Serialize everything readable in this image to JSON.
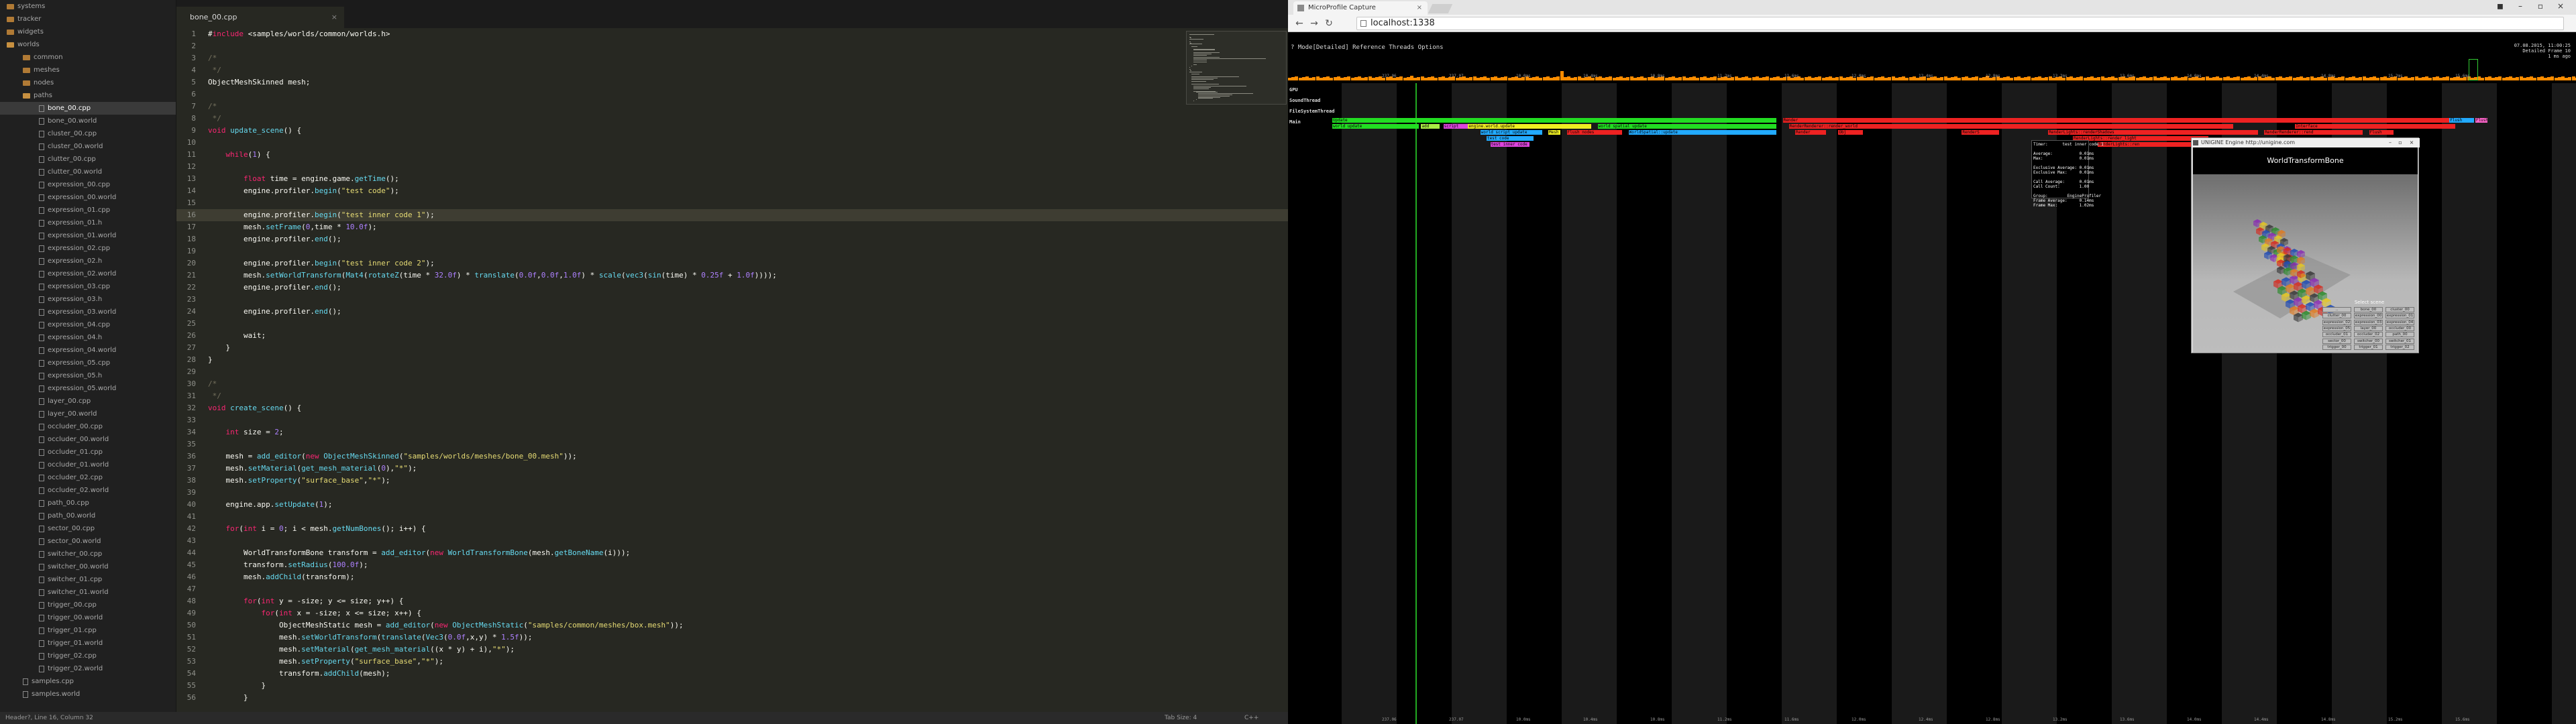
{
  "editor": {
    "tab_title": "bone_00.cpp",
    "status_left": "Header?, Line 16, Column 32",
    "status_tab": "Tab Size: 4",
    "status_lang": "C++",
    "sidebar": [
      {
        "name": "systems",
        "type": "folder",
        "level": 0
      },
      {
        "name": "tracker",
        "type": "folder",
        "level": 0
      },
      {
        "name": "widgets",
        "type": "folder",
        "level": 0
      },
      {
        "name": "worlds",
        "type": "folder-open",
        "level": 0
      },
      {
        "name": "common",
        "type": "folder",
        "level": 1
      },
      {
        "name": "meshes",
        "type": "folder",
        "level": 1
      },
      {
        "name": "nodes",
        "type": "folder",
        "level": 1
      },
      {
        "name": "paths",
        "type": "folder-open",
        "level": 1
      },
      {
        "name": "bone_00.cpp",
        "type": "file",
        "level": 2,
        "selected": true
      },
      {
        "name": "bone_00.world",
        "type": "file",
        "level": 2
      },
      {
        "name": "cluster_00.cpp",
        "type": "file",
        "level": 2
      },
      {
        "name": "cluster_00.world",
        "type": "file",
        "level": 2
      },
      {
        "name": "clutter_00.cpp",
        "type": "file",
        "level": 2
      },
      {
        "name": "clutter_00.world",
        "type": "file",
        "level": 2
      },
      {
        "name": "expression_00.cpp",
        "type": "file",
        "level": 2
      },
      {
        "name": "expression_00.world",
        "type": "file",
        "level": 2
      },
      {
        "name": "expression_01.cpp",
        "type": "file",
        "level": 2
      },
      {
        "name": "expression_01.h",
        "type": "file",
        "level": 2
      },
      {
        "name": "expression_01.world",
        "type": "file",
        "level": 2
      },
      {
        "name": "expression_02.cpp",
        "type": "file",
        "level": 2
      },
      {
        "name": "expression_02.h",
        "type": "file",
        "level": 2
      },
      {
        "name": "expression_02.world",
        "type": "file",
        "level": 2
      },
      {
        "name": "expression_03.cpp",
        "type": "file",
        "level": 2
      },
      {
        "name": "expression_03.h",
        "type": "file",
        "level": 2
      },
      {
        "name": "expression_03.world",
        "type": "file",
        "level": 2
      },
      {
        "name": "expression_04.cpp",
        "type": "file",
        "level": 2
      },
      {
        "name": "expression_04.h",
        "type": "file",
        "level": 2
      },
      {
        "name": "expression_04.world",
        "type": "file",
        "level": 2
      },
      {
        "name": "expression_05.cpp",
        "type": "file",
        "level": 2
      },
      {
        "name": "expression_05.h",
        "type": "file",
        "level": 2
      },
      {
        "name": "expression_05.world",
        "type": "file",
        "level": 2
      },
      {
        "name": "layer_00.cpp",
        "type": "file",
        "level": 2
      },
      {
        "name": "layer_00.world",
        "type": "file",
        "level": 2
      },
      {
        "name": "occluder_00.cpp",
        "type": "file",
        "level": 2
      },
      {
        "name": "occluder_00.world",
        "type": "file",
        "level": 2
      },
      {
        "name": "occluder_01.cpp",
        "type": "file",
        "level": 2
      },
      {
        "name": "occluder_01.world",
        "type": "file",
        "level": 2
      },
      {
        "name": "occluder_02.cpp",
        "type": "file",
        "level": 2
      },
      {
        "name": "occluder_02.world",
        "type": "file",
        "level": 2
      },
      {
        "name": "path_00.cpp",
        "type": "file",
        "level": 2
      },
      {
        "name": "path_00.world",
        "type": "file",
        "level": 2
      },
      {
        "name": "sector_00.cpp",
        "type": "file",
        "level": 2
      },
      {
        "name": "sector_00.world",
        "type": "file",
        "level": 2
      },
      {
        "name": "switcher_00.cpp",
        "type": "file",
        "level": 2
      },
      {
        "name": "switcher_00.world",
        "type": "file",
        "level": 2
      },
      {
        "name": "switcher_01.cpp",
        "type": "file",
        "level": 2
      },
      {
        "name": "switcher_01.world",
        "type": "file",
        "level": 2
      },
      {
        "name": "trigger_00.cpp",
        "type": "file",
        "level": 2
      },
      {
        "name": "trigger_00.world",
        "type": "file",
        "level": 2
      },
      {
        "name": "trigger_01.cpp",
        "type": "file",
        "level": 2
      },
      {
        "name": "trigger_01.world",
        "type": "file",
        "level": 2
      },
      {
        "name": "trigger_02.cpp",
        "type": "file",
        "level": 2
      },
      {
        "name": "trigger_02.world",
        "type": "file",
        "level": 2
      },
      {
        "name": "samples.cpp",
        "type": "file",
        "level": 1
      },
      {
        "name": "samples.world",
        "type": "file",
        "level": 1
      }
    ],
    "code_lines": [
      "#include <samples/worlds/common/worlds.h>",
      "",
      "/*",
      " */",
      "ObjectMeshSkinned mesh;",
      "",
      "/*",
      " */",
      "void update_scene() {",
      "",
      "    while(1) {",
      "",
      "        float time = engine.game.getTime();",
      "        engine.profiler.begin(\"test code\");",
      "",
      "        engine.profiler.begin(\"test inner code 1\");",
      "        mesh.setFrame(0,time * 10.0f);",
      "        engine.profiler.end();",
      "",
      "        engine.profiler.begin(\"test inner code 2\");",
      "        mesh.setWorldTransform(Mat4(rotateZ(time * 32.0f) * translate(0.0f,0.0f,1.0f) * scale(vec3(sin(time) * 0.25f + 1.0f))));",
      "        engine.profiler.end();",
      "",
      "        engine.profiler.end();",
      "",
      "        wait;",
      "    }",
      "}",
      "",
      "/*",
      " */",
      "void create_scene() {",
      "",
      "    int size = 2;",
      "",
      "    mesh = add_editor(new ObjectMeshSkinned(\"samples/worlds/meshes/bone_00.mesh\"));",
      "    mesh.setMaterial(get_mesh_material(0),\"*\");",
      "    mesh.setProperty(\"surface_base\",\"*\");",
      "",
      "    engine.app.setUpdate(1);",
      "",
      "    for(int i = 0; i < mesh.getNumBones(); i++) {",
      "",
      "        WorldTransformBone transform = add_editor(new WorldTransformBone(mesh.getBoneName(i)));",
      "        transform.setRadius(100.0f);",
      "        mesh.addChild(transform);",
      "",
      "        for(int y = -size; y <= size; y++) {",
      "            for(int x = -size; x <= size; x++) {",
      "                ObjectMeshStatic mesh = add_editor(new ObjectMeshStatic(\"samples/common/meshes/box.mesh\"));",
      "                mesh.setWorldTransform(translate(Vec3(0.0f,x,y) * 1.5f));",
      "                mesh.setMaterial(get_mesh_material((x * y) + i),\"*\");",
      "                mesh.setProperty(\"surface_base\",\"*\");",
      "                transform.addChild(mesh);",
      "            }",
      "        }"
    ],
    "current_line": 16
  },
  "browser": {
    "tab_title": "MicroProfile Capture",
    "url": "localhost:1338",
    "colors": {
      "frame_bar": "#ff8c00",
      "timeline_stripe": "#1a1a1a",
      "green_bar": "#22dd22",
      "red_bar": "#ee2222"
    }
  },
  "profiler": {
    "menu": "? Mode[Detailed] Reference Threads Options",
    "top_right_1": "07.08.2015, 11:00:25",
    "top_right_2": "Detailed Frame 10",
    "top_right_3": "1 ms ago",
    "threads": [
      "GPU",
      "SoundThread",
      "FileSystemThread",
      "Main"
    ],
    "time_marks": [
      "237.06",
      "237.07",
      "10.0ms",
      "10.4ms",
      "10.8ms",
      "11.2ms",
      "11.6ms",
      "12.0ms",
      "12.4ms",
      "12.8ms",
      "13.2ms",
      "13.6ms",
      "14.0ms",
      "14.4ms",
      "14.8ms",
      "15.2ms",
      "15.6ms"
    ],
    "bars": [
      {
        "label": "Update",
        "color": "#22dd22",
        "row": 0,
        "start": 0.0,
        "width": 0.36
      },
      {
        "label": "Render",
        "color": "#ee2222",
        "row": 0,
        "start": 0.365,
        "width": 0.54
      },
      {
        "label": "Flush",
        "color": "#22aaff",
        "row": 0,
        "start": 0.905,
        "width": 0.02
      },
      {
        "label": "Flush",
        "color": "#ff66cc",
        "row": 0,
        "start": 0.926,
        "width": 0.01
      },
      {
        "label": "world update",
        "color": "#22dd22",
        "row": 1,
        "start": 0.0,
        "width": 0.07
      },
      {
        "label": "add",
        "color": "#aaee44",
        "row": 1,
        "start": 0.072,
        "width": 0.015
      },
      {
        "label": "script",
        "color": "#dd44dd",
        "row": 1,
        "start": 0.09,
        "width": 0.02
      },
      {
        "label": "engine.world.update",
        "color": "#eeee22",
        "row": 1,
        "start": 0.11,
        "width": 0.1
      },
      {
        "label": "world spatial update",
        "color": "#22dd22",
        "row": 1,
        "start": 0.215,
        "width": 0.145
      },
      {
        "label": "RenderRenderer::render_world",
        "color": "#ee2222",
        "row": 1,
        "start": 0.37,
        "width": 0.36
      },
      {
        "label": "Interface",
        "color": "#ee2222",
        "row": 1,
        "start": 0.78,
        "width": 0.13
      },
      {
        "label": "world script update",
        "color": "#22aaff",
        "row": 2,
        "start": 0.12,
        "width": 0.05
      },
      {
        "label": "Mesh",
        "color": "#eeee22",
        "row": 2,
        "start": 0.175,
        "width": 0.01
      },
      {
        "label": "Flush nodes",
        "color": "#ee2222",
        "row": 2,
        "start": 0.19,
        "width": 0.045
      },
      {
        "label": "WorldSpatial::update",
        "color": "#22aaff",
        "row": 2,
        "start": 0.24,
        "width": 0.12
      },
      {
        "label": "Render",
        "color": "#ee2222",
        "row": 2,
        "start": 0.375,
        "width": 0.025
      },
      {
        "label": "Obj",
        "color": "#ee2222",
        "row": 2,
        "start": 0.41,
        "width": 0.02
      },
      {
        "label": "RenderS",
        "color": "#ee2222",
        "row": 2,
        "start": 0.51,
        "width": 0.03
      },
      {
        "label": "RenderLights::renderShadows",
        "color": "#ee2222",
        "row": 2,
        "start": 0.58,
        "width": 0.17
      },
      {
        "label": "RenderRenderer::rend",
        "color": "#ee2222",
        "row": 2,
        "start": 0.755,
        "width": 0.08
      },
      {
        "label": "Flush",
        "color": "#ee2222",
        "row": 2,
        "start": 0.84,
        "width": 0.02
      },
      {
        "label": "test code",
        "color": "#22aaff",
        "row": 3,
        "start": 0.125,
        "width": 0.038
      },
      {
        "label": "test inner code",
        "color": "#dd44dd",
        "row": 4,
        "start": 0.128,
        "width": 0.032
      },
      {
        "label": "RenderLights::render_light",
        "color": "#ee2222",
        "row": 3,
        "start": 0.6,
        "width": 0.11
      },
      {
        "label": "RenderLights::ren",
        "color": "#ee2222",
        "row": 4,
        "start": 0.62,
        "width": 0.08
      },
      {
        "label": "RenderLights",
        "color": "#ee2222",
        "row": 4,
        "start": 0.76,
        "width": 0.05
      }
    ],
    "tooltip": [
      "Timer:      test inner code 1",
      "",
      "Average:           0.01ms",
      "Max:               0.01ms",
      "",
      "Exclusive Average: 0.01ms",
      "Exclusive Max:     0.01ms",
      "",
      "Call Average:      0.01ms",
      "Call Count:        1.00",
      "",
      "Group:        EngineProfiler",
      "Frame Average:     0.14ms",
      "Frame Max:         1.02ms"
    ]
  },
  "unigine": {
    "window_title": "UNIGINE Engine http://unigine.com",
    "header": "WorldTransformBone",
    "select_scene": "Select scene",
    "buttons": [
      "..",
      "bone_00",
      "cluster_00",
      "clutter_00",
      "expression_00",
      "expression_01",
      "expression_02",
      "expression_03",
      "expression_04",
      "expression_05",
      "layer_00",
      "occluder_00",
      "occluder_01",
      "occluder_02",
      "path_00",
      "sector_00",
      "switcher_00",
      "switcher_01",
      "trigger_00",
      "trigger_01",
      "trigger_02"
    ]
  }
}
